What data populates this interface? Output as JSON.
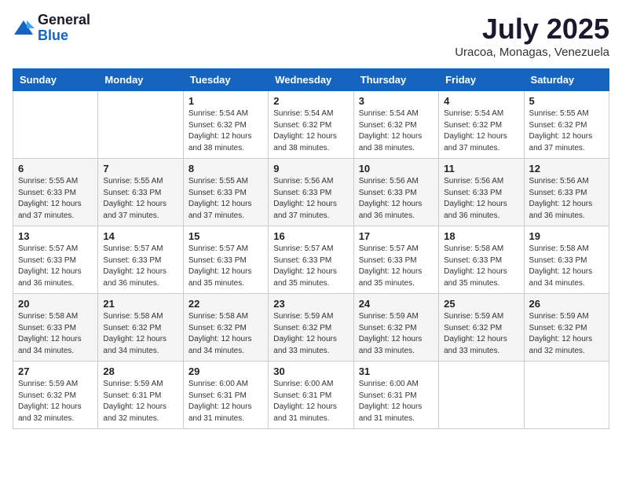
{
  "header": {
    "logo_general": "General",
    "logo_blue": "Blue",
    "month_title": "July 2025",
    "location": "Uracoa, Monagas, Venezuela"
  },
  "weekdays": [
    "Sunday",
    "Monday",
    "Tuesday",
    "Wednesday",
    "Thursday",
    "Friday",
    "Saturday"
  ],
  "weeks": [
    [
      {
        "day": "",
        "info": ""
      },
      {
        "day": "",
        "info": ""
      },
      {
        "day": "1",
        "info": "Sunrise: 5:54 AM\nSunset: 6:32 PM\nDaylight: 12 hours and 38 minutes."
      },
      {
        "day": "2",
        "info": "Sunrise: 5:54 AM\nSunset: 6:32 PM\nDaylight: 12 hours and 38 minutes."
      },
      {
        "day": "3",
        "info": "Sunrise: 5:54 AM\nSunset: 6:32 PM\nDaylight: 12 hours and 38 minutes."
      },
      {
        "day": "4",
        "info": "Sunrise: 5:54 AM\nSunset: 6:32 PM\nDaylight: 12 hours and 37 minutes."
      },
      {
        "day": "5",
        "info": "Sunrise: 5:55 AM\nSunset: 6:32 PM\nDaylight: 12 hours and 37 minutes."
      }
    ],
    [
      {
        "day": "6",
        "info": "Sunrise: 5:55 AM\nSunset: 6:33 PM\nDaylight: 12 hours and 37 minutes."
      },
      {
        "day": "7",
        "info": "Sunrise: 5:55 AM\nSunset: 6:33 PM\nDaylight: 12 hours and 37 minutes."
      },
      {
        "day": "8",
        "info": "Sunrise: 5:55 AM\nSunset: 6:33 PM\nDaylight: 12 hours and 37 minutes."
      },
      {
        "day": "9",
        "info": "Sunrise: 5:56 AM\nSunset: 6:33 PM\nDaylight: 12 hours and 37 minutes."
      },
      {
        "day": "10",
        "info": "Sunrise: 5:56 AM\nSunset: 6:33 PM\nDaylight: 12 hours and 36 minutes."
      },
      {
        "day": "11",
        "info": "Sunrise: 5:56 AM\nSunset: 6:33 PM\nDaylight: 12 hours and 36 minutes."
      },
      {
        "day": "12",
        "info": "Sunrise: 5:56 AM\nSunset: 6:33 PM\nDaylight: 12 hours and 36 minutes."
      }
    ],
    [
      {
        "day": "13",
        "info": "Sunrise: 5:57 AM\nSunset: 6:33 PM\nDaylight: 12 hours and 36 minutes."
      },
      {
        "day": "14",
        "info": "Sunrise: 5:57 AM\nSunset: 6:33 PM\nDaylight: 12 hours and 36 minutes."
      },
      {
        "day": "15",
        "info": "Sunrise: 5:57 AM\nSunset: 6:33 PM\nDaylight: 12 hours and 35 minutes."
      },
      {
        "day": "16",
        "info": "Sunrise: 5:57 AM\nSunset: 6:33 PM\nDaylight: 12 hours and 35 minutes."
      },
      {
        "day": "17",
        "info": "Sunrise: 5:57 AM\nSunset: 6:33 PM\nDaylight: 12 hours and 35 minutes."
      },
      {
        "day": "18",
        "info": "Sunrise: 5:58 AM\nSunset: 6:33 PM\nDaylight: 12 hours and 35 minutes."
      },
      {
        "day": "19",
        "info": "Sunrise: 5:58 AM\nSunset: 6:33 PM\nDaylight: 12 hours and 34 minutes."
      }
    ],
    [
      {
        "day": "20",
        "info": "Sunrise: 5:58 AM\nSunset: 6:33 PM\nDaylight: 12 hours and 34 minutes."
      },
      {
        "day": "21",
        "info": "Sunrise: 5:58 AM\nSunset: 6:32 PM\nDaylight: 12 hours and 34 minutes."
      },
      {
        "day": "22",
        "info": "Sunrise: 5:58 AM\nSunset: 6:32 PM\nDaylight: 12 hours and 34 minutes."
      },
      {
        "day": "23",
        "info": "Sunrise: 5:59 AM\nSunset: 6:32 PM\nDaylight: 12 hours and 33 minutes."
      },
      {
        "day": "24",
        "info": "Sunrise: 5:59 AM\nSunset: 6:32 PM\nDaylight: 12 hours and 33 minutes."
      },
      {
        "day": "25",
        "info": "Sunrise: 5:59 AM\nSunset: 6:32 PM\nDaylight: 12 hours and 33 minutes."
      },
      {
        "day": "26",
        "info": "Sunrise: 5:59 AM\nSunset: 6:32 PM\nDaylight: 12 hours and 32 minutes."
      }
    ],
    [
      {
        "day": "27",
        "info": "Sunrise: 5:59 AM\nSunset: 6:32 PM\nDaylight: 12 hours and 32 minutes."
      },
      {
        "day": "28",
        "info": "Sunrise: 5:59 AM\nSunset: 6:31 PM\nDaylight: 12 hours and 32 minutes."
      },
      {
        "day": "29",
        "info": "Sunrise: 6:00 AM\nSunset: 6:31 PM\nDaylight: 12 hours and 31 minutes."
      },
      {
        "day": "30",
        "info": "Sunrise: 6:00 AM\nSunset: 6:31 PM\nDaylight: 12 hours and 31 minutes."
      },
      {
        "day": "31",
        "info": "Sunrise: 6:00 AM\nSunset: 6:31 PM\nDaylight: 12 hours and 31 minutes."
      },
      {
        "day": "",
        "info": ""
      },
      {
        "day": "",
        "info": ""
      }
    ]
  ]
}
